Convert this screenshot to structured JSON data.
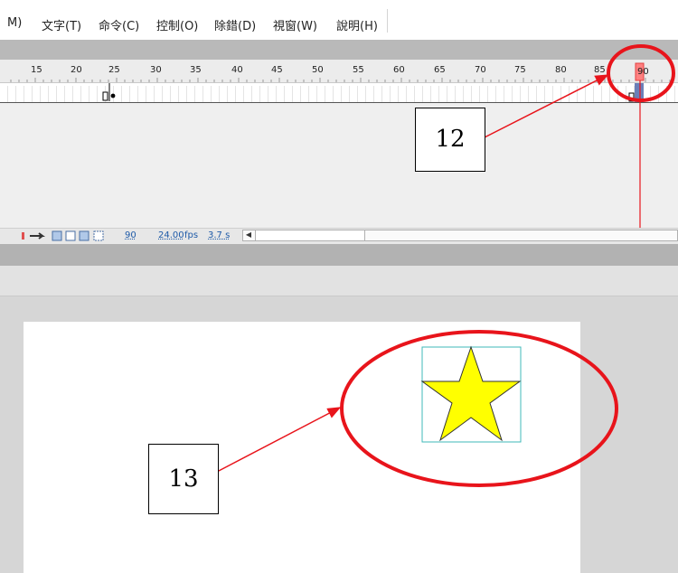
{
  "menu": {
    "items": [
      "M)",
      "文字(T)",
      "命令(C)",
      "控制(O)",
      "除錯(D)",
      "視窗(W)",
      "說明(H)"
    ]
  },
  "timeline": {
    "ruler_ticks": [
      "15",
      "20",
      "25",
      "30",
      "35",
      "40",
      "45",
      "50",
      "55",
      "60",
      "65",
      "70",
      "75",
      "80",
      "85",
      "90"
    ],
    "current_frame_marker": "90"
  },
  "status": {
    "frame": "90",
    "fps": "24.00",
    "fps_unit": "fps",
    "time": "3.7 s"
  },
  "annotations": {
    "callout_12": "12",
    "callout_13": "13"
  },
  "colors": {
    "annotation_red": "#e8141b",
    "star_fill": "#ffff00",
    "selection_box": "#3fb9b9",
    "playhead": "#ff8080"
  },
  "icons": [
    "onion-skin-icon",
    "edit-multiple-frames-icon",
    "onion-outline-icon",
    "onion-frames-icon",
    "modify-markers-icon",
    "arrow-icon",
    "scroll-left-icon"
  ]
}
